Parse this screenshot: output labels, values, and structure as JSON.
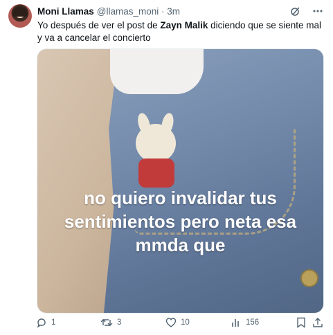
{
  "tweet": {
    "author_name": "Moni Llamas",
    "handle_time": "@llamas_moni · 3m",
    "text_part1": "Yo después de ver el post de ",
    "text_bold": "Zayn Malik",
    "text_part2": " diciendo que se siente mal y va a cancelar el concierto"
  },
  "media": {
    "caption_lines": [
      "no quiero invalidar tus",
      "sentimientos pero neta esa",
      "mmda que"
    ]
  },
  "actions": {
    "reply_count": "1",
    "retweet_count": "3",
    "like_count": "10",
    "views_count": "156"
  },
  "icons": [
    "grok-icon",
    "more-icon",
    "reply-icon",
    "retweet-icon",
    "like-icon",
    "views-icon",
    "bookmark-icon",
    "share-icon"
  ],
  "colors": {
    "text": "#0f1419",
    "muted": "#536471",
    "caption": "#ffffff"
  }
}
